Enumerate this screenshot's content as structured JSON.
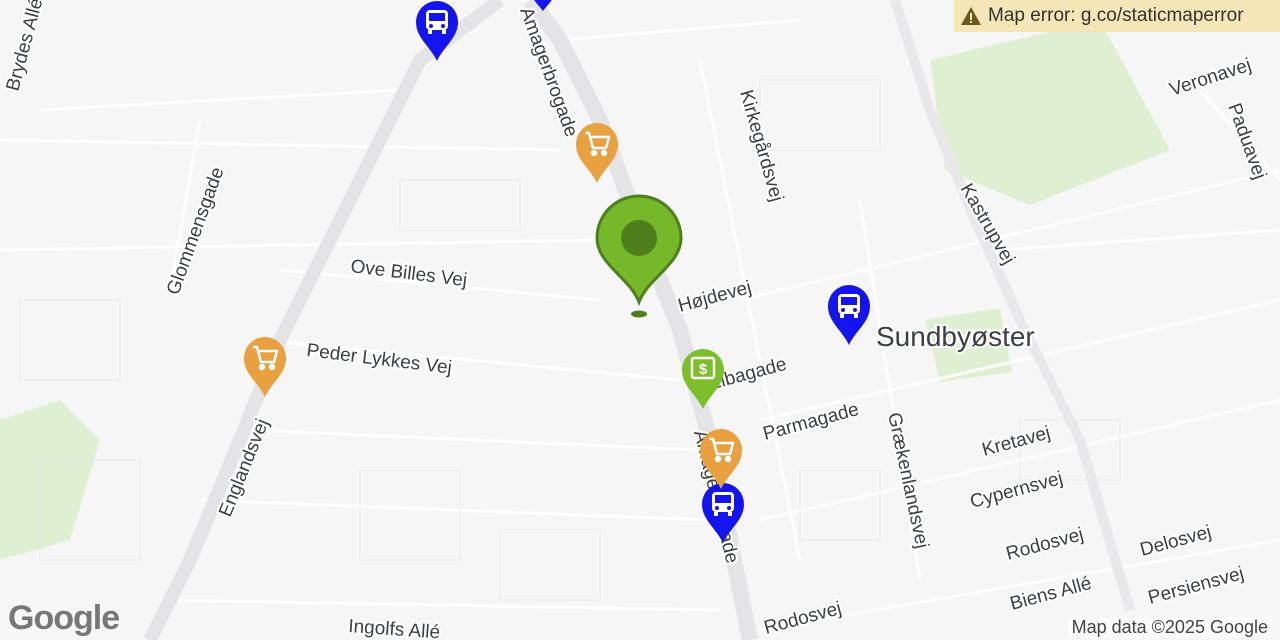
{
  "map": {
    "error_text": "Map error: g.co/staticmaperror",
    "attribution": "Map data ©2025 Google",
    "logo": "Google",
    "area_label": "Sundbyøster",
    "streets": {
      "brydes": "Brydes Allé",
      "glommensgade": "Glommensgade",
      "ove_billes": "Ove Billes Vej",
      "peder_lykkes": "Peder Lykkes Vej",
      "englandsvej": "Englandsvej",
      "ingolfs": "Ingolfs Allé",
      "kirkegardsvej": "Kirkegårdsvej",
      "hojdevej": "Højdevej",
      "elbagade": "Elbagade",
      "parmagade": "Parmagade",
      "graekenlandsvej": "Grækenlandsvej",
      "kastrupvej": "Kastrupvej",
      "veronavej": "Veronavej",
      "paduavej": "Paduavej",
      "kretavej": "Kretavej",
      "cypernsvej": "Cypernsvej",
      "rodosvej_1": "Rodosvej",
      "rodosvej_2": "Rodosvej",
      "delosvej": "Delosvej",
      "persiensvej": "Persiensvej",
      "biens": "Biens Allé",
      "amagerbrogade_bottom": "Amagerbrogade",
      "amagerbrogade_top": "Amagerbrogade"
    },
    "markers": [
      {
        "type": "bus",
        "color": "#1a1aff",
        "icon": "bus-icon"
      },
      {
        "type": "bus",
        "color": "#1a1aff",
        "icon": "bus-icon"
      },
      {
        "type": "bus",
        "color": "#1a1aff",
        "icon": "bus-icon"
      },
      {
        "type": "shopping",
        "color": "#e8a040",
        "icon": "cart-icon"
      },
      {
        "type": "shopping",
        "color": "#e8a040",
        "icon": "cart-icon"
      },
      {
        "type": "shopping",
        "color": "#e8a040",
        "icon": "cart-icon"
      },
      {
        "type": "atm",
        "color": "#7cbf2a",
        "icon": "money-icon"
      },
      {
        "type": "location",
        "color": "#76b82a",
        "icon": "location-pin-icon"
      }
    ]
  }
}
